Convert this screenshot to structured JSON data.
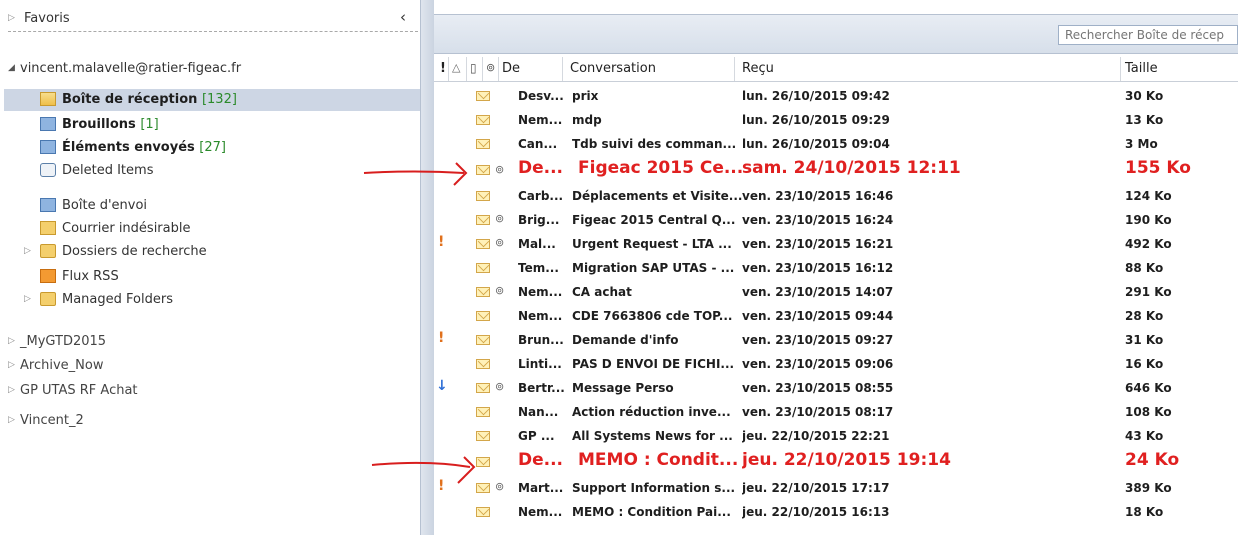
{
  "nav": {
    "favorites_label": "Favoris",
    "account_label": "vincent.malavelle@ratier-figeac.fr",
    "folders": [
      {
        "label": "Boîte de réception",
        "count": "[132]",
        "icon": "inbox-folder-icon",
        "bold": true,
        "selected": true
      },
      {
        "label": "Brouillons",
        "count": "[1]",
        "icon": "drafts-folder-icon",
        "bold": true
      },
      {
        "label": "Éléments envoyés",
        "count": "[27]",
        "icon": "sent-folder-icon",
        "bold": true
      },
      {
        "label": "Deleted Items",
        "count": "",
        "icon": "deleted-items-icon"
      },
      {
        "label": "Boîte d'envoi",
        "count": "",
        "icon": "outbox-folder-icon"
      },
      {
        "label": "Courrier indésirable",
        "count": "",
        "icon": "junk-folder-icon"
      },
      {
        "label": "Dossiers de recherche",
        "count": "",
        "icon": "search-folder-icon",
        "expandable": true
      },
      {
        "label": "Flux RSS",
        "count": "",
        "icon": "rss-folder-icon"
      },
      {
        "label": "Managed Folders",
        "count": "",
        "icon": "managed-folder-icon",
        "expandable": true
      }
    ],
    "roots": [
      "_MyGTD2015",
      "Archive_Now",
      "GP UTAS RF Achat",
      "Vincent_2"
    ]
  },
  "search": {
    "placeholder": "Rechercher Boîte de récep"
  },
  "columns": {
    "importance": "!",
    "reminder": "🔔",
    "type": "🗋",
    "attachment": "📎",
    "from": "De",
    "conversation": "Conversation",
    "received": "Reçu",
    "size": "Taille"
  },
  "messages": [
    {
      "from": "Desv...",
      "subject": "prix",
      "received": "lun. 26/10/2015 09:42",
      "size": "30 Ko",
      "attach": false,
      "flag": ""
    },
    {
      "from": "Nem...",
      "subject": "mdp",
      "received": "lun. 26/10/2015 09:29",
      "size": "13 Ko",
      "attach": false,
      "flag": ""
    },
    {
      "from": "Can...",
      "subject": "Tdb suivi des comman...",
      "received": "lun. 26/10/2015 09:04",
      "size": "3 Mo",
      "attach": false,
      "flag": ""
    },
    {
      "from": "De...",
      "subject": "Figeac 2015 Ce...",
      "received": "sam. 24/10/2015 12:11",
      "size": "155 Ko",
      "attach": true,
      "flag": "",
      "highlight": true
    },
    {
      "from": "Carb...",
      "subject": "Déplacements et Visite...",
      "received": "ven. 23/10/2015 16:46",
      "size": "124 Ko",
      "attach": false,
      "flag": ""
    },
    {
      "from": "Brig...",
      "subject": "Figeac 2015 Central Q...",
      "received": "ven. 23/10/2015 16:24",
      "size": "190 Ko",
      "attach": true,
      "flag": ""
    },
    {
      "from": "Mal...",
      "subject": "Urgent Request - LTA ...",
      "received": "ven. 23/10/2015 16:21",
      "size": "492 Ko",
      "attach": true,
      "flag": "high"
    },
    {
      "from": "Tem...",
      "subject": "Migration SAP UTAS - ...",
      "received": "ven. 23/10/2015 16:12",
      "size": "88 Ko",
      "attach": false,
      "flag": ""
    },
    {
      "from": "Nem...",
      "subject": "CA achat",
      "received": "ven. 23/10/2015 14:07",
      "size": "291 Ko",
      "attach": true,
      "flag": ""
    },
    {
      "from": "Nem...",
      "subject": "CDE 7663806  cde TOP...",
      "received": "ven. 23/10/2015 09:44",
      "size": "28 Ko",
      "attach": false,
      "flag": ""
    },
    {
      "from": "Brun...",
      "subject": "Demande d'info",
      "received": "ven. 23/10/2015 09:27",
      "size": "31 Ko",
      "attach": false,
      "flag": "high"
    },
    {
      "from": "Linti...",
      "subject": "PAS D ENVOI DE FICHI...",
      "received": "ven. 23/10/2015 09:06",
      "size": "16 Ko",
      "attach": false,
      "flag": ""
    },
    {
      "from": "Bertr...",
      "subject": "Message Perso",
      "received": "ven. 23/10/2015 08:55",
      "size": "646 Ko",
      "attach": true,
      "flag": "low"
    },
    {
      "from": "Nan...",
      "subject": "Action réduction inve...",
      "received": "ven. 23/10/2015 08:17",
      "size": "108 Ko",
      "attach": false,
      "flag": ""
    },
    {
      "from": "GP ...",
      "subject": "All Systems News for ...",
      "received": "jeu. 22/10/2015 22:21",
      "size": "43 Ko",
      "attach": false,
      "flag": ""
    },
    {
      "from": "De...",
      "subject": "MEMO : Condit...",
      "received": "jeu. 22/10/2015 19:14",
      "size": "24 Ko",
      "attach": false,
      "flag": "",
      "highlight": true
    },
    {
      "from": "Mart...",
      "subject": "Support Information s...",
      "received": "jeu. 22/10/2015 17:17",
      "size": "389 Ko",
      "attach": true,
      "flag": "high"
    },
    {
      "from": "Nem...",
      "subject": "MEMO : Condition Pai...",
      "received": "jeu. 22/10/2015 16:13",
      "size": "18 Ko",
      "attach": false,
      "flag": ""
    }
  ],
  "colors": {
    "highlight": "#e02020",
    "count": "#2b8a2b",
    "selected_bg": "#cdd6e4",
    "importance_high": "#e0701c",
    "importance_low": "#2f6fd6"
  }
}
